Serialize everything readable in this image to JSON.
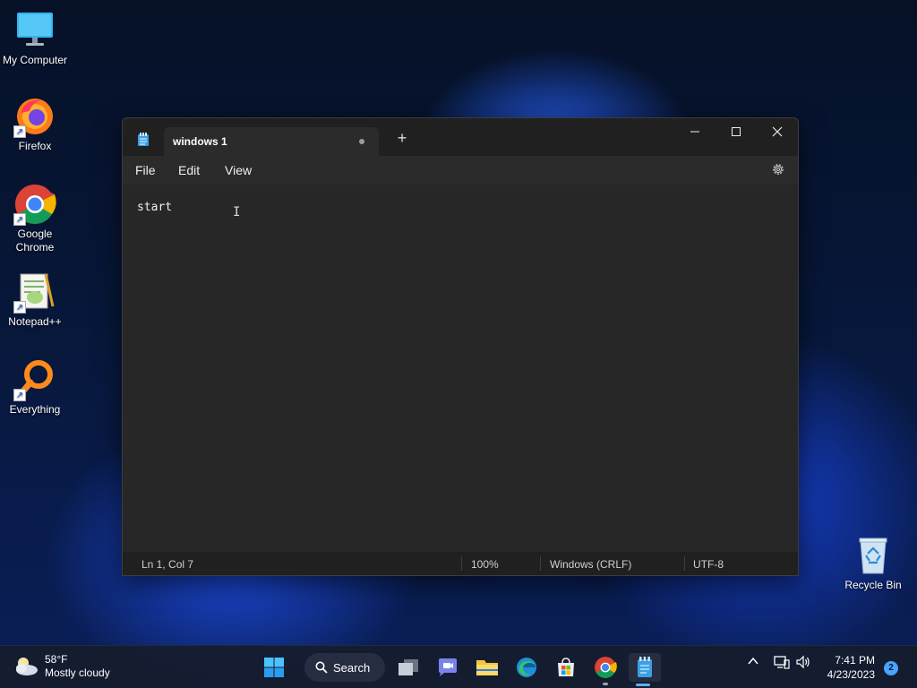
{
  "desktop": {
    "icons": [
      {
        "label": "My Computer"
      },
      {
        "label": "Firefox"
      },
      {
        "label": "Google Chrome"
      },
      {
        "label": "Notepad++"
      },
      {
        "label": "Everything"
      },
      {
        "label": "Recycle Bin"
      }
    ]
  },
  "notepad": {
    "tab_title": "windows 1",
    "menu": {
      "file": "File",
      "edit": "Edit",
      "view": "View"
    },
    "content": "start",
    "status": {
      "position": "Ln 1, Col 7",
      "zoom": "100%",
      "line_ending": "Windows (CRLF)",
      "encoding": "UTF-8"
    }
  },
  "taskbar": {
    "weather_temp": "58°F",
    "weather_desc": "Mostly cloudy",
    "search_label": "Search",
    "time": "7:41 PM",
    "date": "4/23/2023",
    "notification_count": "2"
  },
  "colors": {
    "accent": "#5ab0ff",
    "window_bg": "#272727",
    "titlebar_bg": "#202020"
  }
}
